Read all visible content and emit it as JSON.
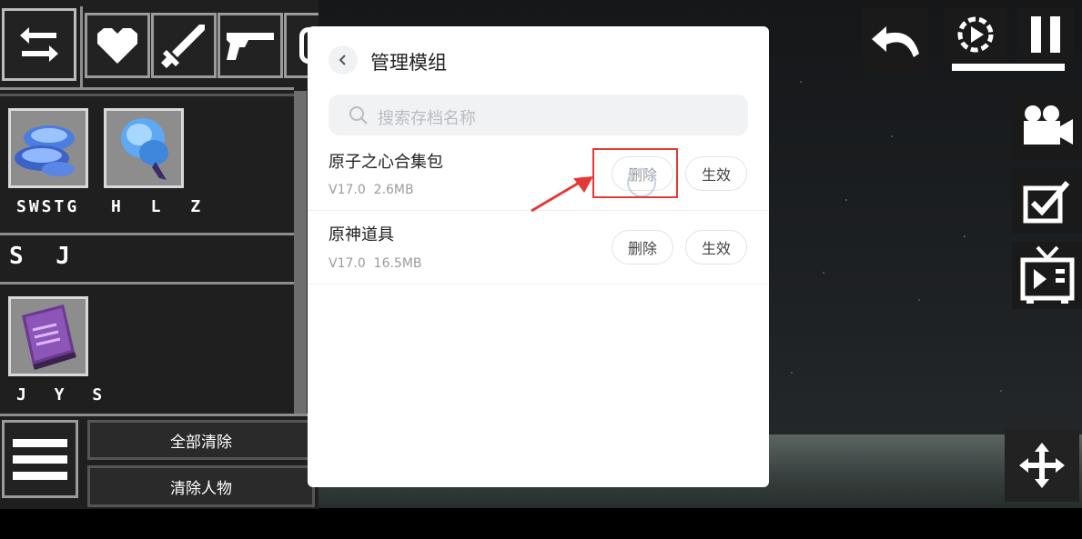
{
  "left_panel": {
    "category_icons": [
      "swap-icon",
      "heart-icon",
      "sword-icon",
      "gun-icon"
    ],
    "groups": [
      {
        "items": [
          {
            "name": "SWSTG"
          },
          {
            "name": "H L Z"
          }
        ]
      },
      {
        "label": "S J"
      },
      {
        "items": [
          {
            "name": "J Y S"
          }
        ]
      }
    ],
    "clear_all_label": "全部清除",
    "clear_people_label": "清除人物"
  },
  "dialog": {
    "title": "管理模组",
    "search_placeholder": "搜索存档名称",
    "mods": [
      {
        "name": "原子之心合集包",
        "version": "V17.0",
        "size": "2.6MB",
        "delete_label": "删除",
        "apply_label": "生效"
      },
      {
        "name": "原神道具",
        "version": "V17.0",
        "size": "16.5MB",
        "delete_label": "删除",
        "apply_label": "生效"
      }
    ]
  },
  "toolbar": {
    "icons": [
      "undo-icon",
      "slow-motion-icon",
      "pause-icon",
      "camera-icon",
      "checkbox-icon",
      "tv-icon",
      "move-icon"
    ]
  },
  "colors": {
    "highlight": "#e53935",
    "panel": "#1f1f1f",
    "border": "#8d8d8d"
  }
}
